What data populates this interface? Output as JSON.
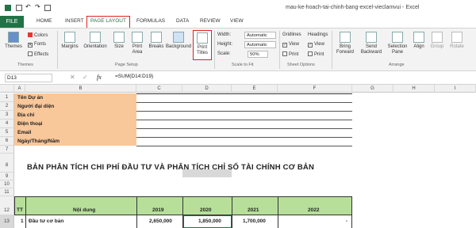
{
  "window_title": "mau-ke-hoach-tai-chinh-bang-excel-vieclamvui - Excel",
  "tabs": [
    "FILE",
    "HOME",
    "INSERT",
    "PAGE LAYOUT",
    "FORMULAS",
    "DATA",
    "REVIEW",
    "VIEW"
  ],
  "ribbon": {
    "themes": {
      "themes": "Themes",
      "colors": "Colors",
      "fonts": "Fonts",
      "effects": "Effects",
      "group": "Themes"
    },
    "page_setup": {
      "margins": "Margins",
      "orientation": "Orientation",
      "size": "Size",
      "print_area_1": "Print",
      "print_area_2": "Area",
      "breaks": "Breaks",
      "background": "Background",
      "print_titles_1": "Print",
      "print_titles_2": "Titles",
      "group": "Page Setup"
    },
    "scale": {
      "width_label": "Width:",
      "width_value": "Automatic",
      "height_label": "Height:",
      "height_value": "Automatic",
      "scale_label": "Scale:",
      "scale_value": "50%",
      "group": "Scale to Fit"
    },
    "sheet_options": {
      "gridlines": "Gridlines",
      "headings": "Headings",
      "view": "View",
      "print": "Print",
      "group": "Sheet Options"
    },
    "arrange": {
      "bring_1": "Bring",
      "bring_2": "Forward",
      "send_1": "Send",
      "send_2": "Backward",
      "selection_1": "Selection",
      "selection_2": "Pane",
      "align": "Align",
      "group_btn": "Group",
      "rotate": "Rotate",
      "group": "Arrange"
    }
  },
  "formula_bar": {
    "name_box": "D13",
    "fx": "fx",
    "formula": "=SUM(D14:D19)"
  },
  "columns": [
    "A",
    "B",
    "C",
    "D",
    "E",
    "F",
    "G",
    "H",
    "I"
  ],
  "rows": [
    "1",
    "2",
    "3",
    "4",
    "5",
    "6",
    "7",
    "8",
    "9",
    "10",
    "11",
    "12",
    "13"
  ],
  "info_labels": [
    "Tên Dự án",
    "Người đại diện",
    "Địa chỉ",
    "Điện thoại",
    "Email",
    "Ngày/Tháng/Năm"
  ],
  "sheet_title": "BẢN PHÂN TÍCH CHI PHÍ ĐẦU TƯ VÀ PHÂN TÍCH CHỈ SỐ TÀI CHÍNH CƠ BẢN",
  "table": {
    "headers": [
      "TT",
      "Nội dung",
      "2019",
      "2020",
      "2021",
      "2022"
    ],
    "row13": [
      "1",
      "Đầu tư cơ bản",
      "2,650,000",
      "1,850,000",
      "1,700,000",
      "-"
    ]
  }
}
